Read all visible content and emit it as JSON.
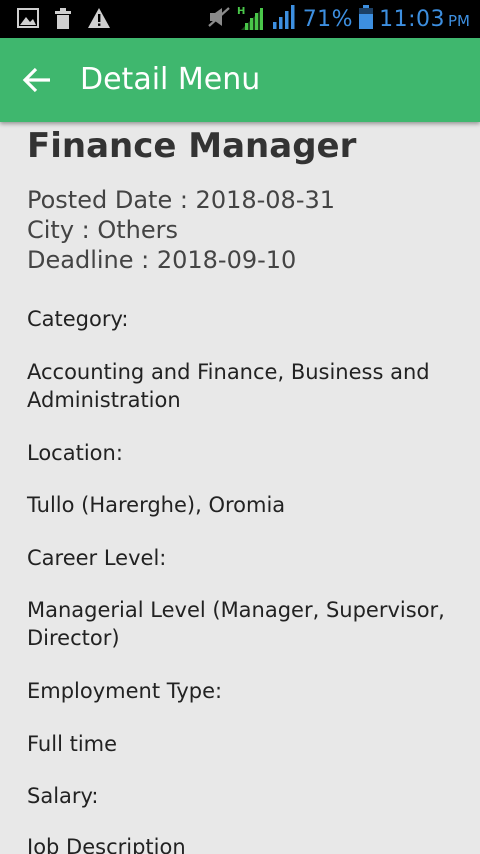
{
  "status_bar": {
    "icons_left": [
      "image-icon",
      "trash-icon",
      "warning-icon"
    ],
    "icons_right": [
      "mute-icon",
      "signal-h-icon",
      "signal-icon",
      "battery-icon"
    ],
    "battery": "71%",
    "time": "11:03",
    "time_suffix": "PM",
    "accent_color": "#3d8fe0"
  },
  "app_bar": {
    "title": "Detail Menu",
    "color": "#3fb76e"
  },
  "job": {
    "title": "Finance Manager",
    "posted_date": "Posted Date : 2018-08-31",
    "city": "City : Others",
    "deadline": "Deadline : 2018-09-10",
    "category_label": "Category:",
    "category_value": "Accounting and Finance, Business and Administration",
    "location_label": "Location:",
    "location_value": "Tullo (Harerghe), Oromia",
    "career_label": "Career Level:",
    "career_value": "Managerial Level (Manager, Supervisor, Director)",
    "employment_label": "Employment Type:",
    "employment_value": "Full time",
    "salary_label": "Salary:",
    "description_label": "Job Description"
  }
}
